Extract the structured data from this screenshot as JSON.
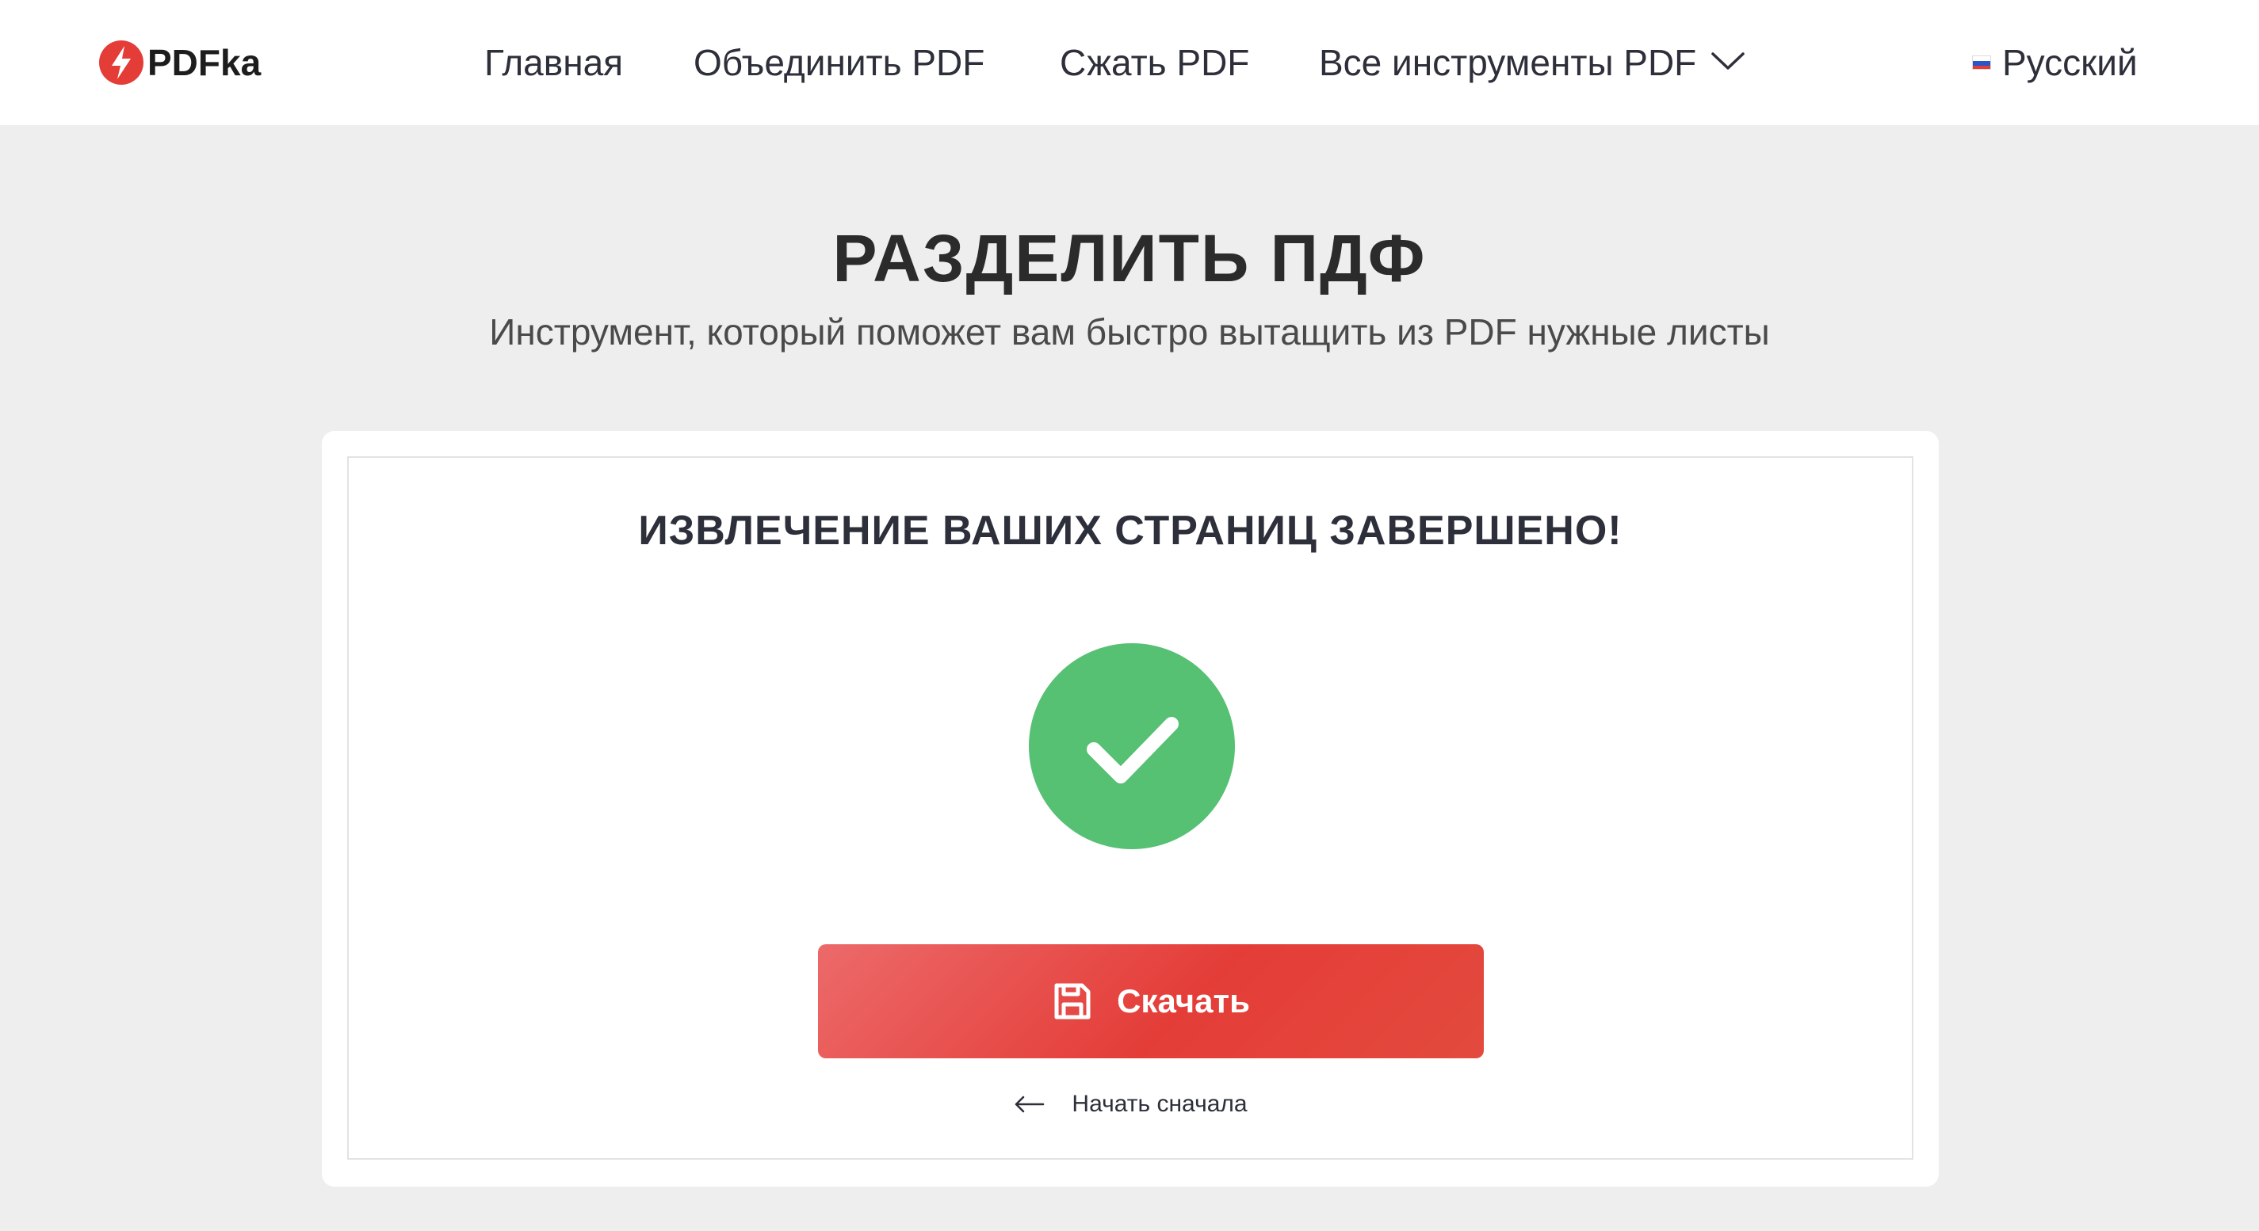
{
  "header": {
    "logo_text": "PDFka",
    "nav": [
      {
        "label": "Главная"
      },
      {
        "label": "Объединить PDF"
      },
      {
        "label": "Сжать PDF"
      },
      {
        "label": "Все инструменты PDF"
      }
    ],
    "language": "Русский"
  },
  "hero": {
    "title": "РАЗДЕЛИТЬ ПДФ",
    "subtitle": "Инструмент, который поможет вам быстро вытащить из PDF нужные листы"
  },
  "result": {
    "title": "ИЗВЛЕЧЕНИЕ ВАШИХ СТРАНИЦ ЗАВЕРШЕНО!",
    "download_label": "Скачать",
    "restart_label": "Начать сначала"
  },
  "icons": {
    "logo": "bolt-logo-icon",
    "nav_dropdown": "chevron-down-icon",
    "flag": "russia-flag-icon",
    "success": "checkmark-icon",
    "download": "floppy-disk-icon",
    "restart": "arrow-left-icon"
  },
  "colors": {
    "accent_red": "#e43d38",
    "success_green": "#56c073",
    "page_background": "#eeeeee",
    "text_dark": "#2d2f3a"
  }
}
